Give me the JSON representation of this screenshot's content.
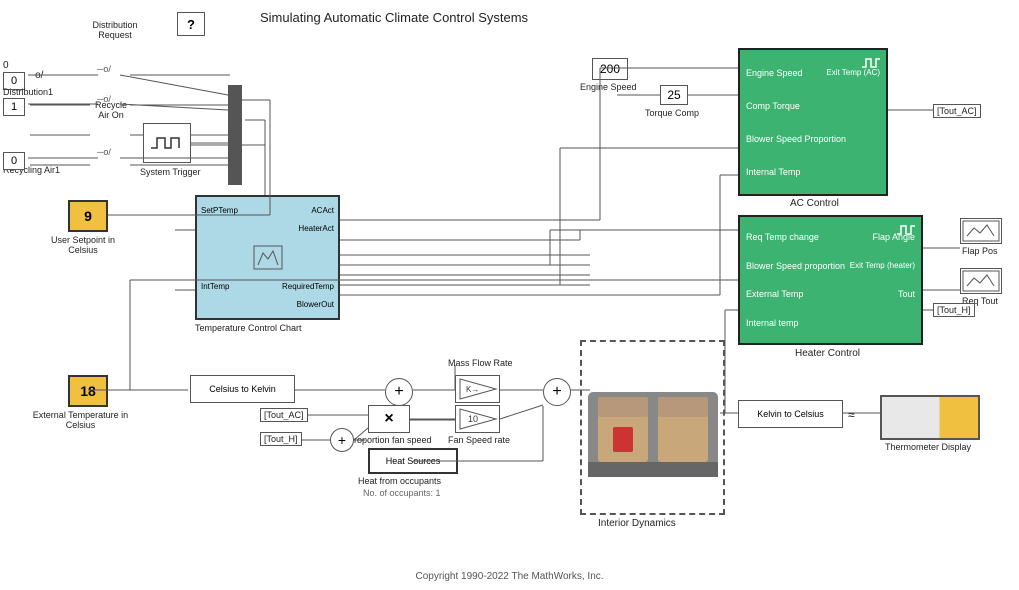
{
  "title": "Simulating Automatic Climate Control Systems",
  "copyright": "Copyright 1990-2022 The MathWorks, Inc.",
  "blocks": {
    "ac_control": {
      "label": "AC Control",
      "inputs": [
        "Engine Speed",
        "Comp Torque",
        "Blower Speed Proportion",
        "Internal Temp"
      ],
      "output": "Exit Temp (AC)"
    },
    "heater_control": {
      "label": "Heater Control",
      "inputs": [
        "Req Temp change",
        "Blower Speed proportion",
        "External Temp",
        "Internal temp"
      ],
      "outputs": [
        "Flap Angle",
        "Exit Temp (heater)",
        "Tout"
      ]
    },
    "temp_control_chart": {
      "label": "Temperature Control Chart",
      "ports_out": [
        "ACAct",
        "HeaterAct",
        "RequiredTemp",
        "BlowerOut"
      ],
      "ports_in": [
        "SetPTemp",
        "IntTemp"
      ]
    },
    "constants": {
      "engine_speed_val": "200",
      "engine_speed_label": "Engine Speed",
      "torque_val": "25",
      "torque_label": "Torque Comp",
      "setpoint_val": "9",
      "setpoint_label": "User Setpoint in Celsius",
      "external_temp_val": "18",
      "external_temp_label": "External Temperature in Celsius",
      "dist_val": "0",
      "dist1_val": "1",
      "dist2_val": "0"
    },
    "celsius_kelvin": {
      "label": "Celsius to Kelvin"
    },
    "kelvin_celsius": {
      "label": "Kelvin to Celsius"
    },
    "mass_flow_rate": {
      "label": "Mass Flow Rate"
    },
    "prop_fan_speed": {
      "label": "Proportion fan speed"
    },
    "fan_speed_rate": {
      "label": "Fan Speed rate"
    },
    "heat_sources": {
      "label": "Heat Sources"
    },
    "heat_occupants": {
      "label": "Heat from occupants"
    },
    "no_occupants": {
      "label": "No. of occupants: 1"
    },
    "thermometer": {
      "label": "Thermometer Display"
    },
    "system_trigger": {
      "label": "System Trigger"
    },
    "question_mark": {
      "label": "?"
    },
    "distribution": {
      "label": "Distribution"
    },
    "distribution_request": {
      "label": "Distribution\nRequest"
    },
    "distribution1": {
      "label": "Distribution1"
    },
    "recycling_air": {
      "label": "Recycle\nAir On"
    },
    "recycling_air1": {
      "label": "Recycling Air1"
    },
    "tout_ac": {
      "label": "[Tout_AC]"
    },
    "tout_h": {
      "label": "[Tout_H]"
    },
    "tout_ac2": {
      "label": "[Tout_AC]"
    },
    "tout_h2": {
      "label": "[Tout_H]"
    },
    "tout_ac_out": {
      "label": "[Tout_AC]"
    },
    "tout_h_out": {
      "label": "[Tout_H]"
    },
    "flap_pos": {
      "label": "Flap Pos"
    },
    "req_tout": {
      "label": "Req Tout"
    },
    "interior_dynamics": {
      "label": "Interior Dynamics"
    },
    "gain_10": {
      "label": "10"
    }
  }
}
